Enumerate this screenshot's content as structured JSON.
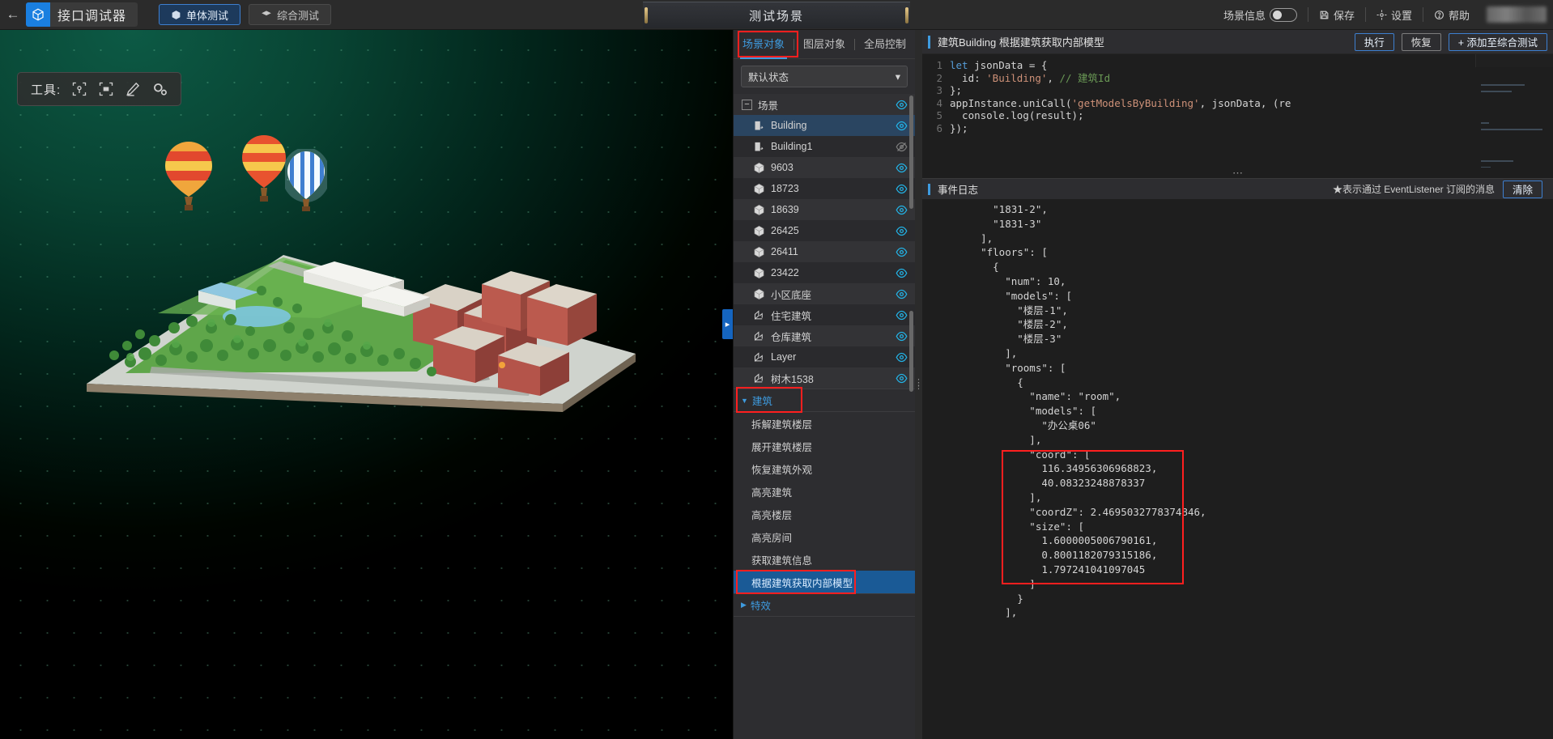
{
  "topbar": {
    "back_icon": "back-arrow-icon",
    "brand_logo_icon": "cube-logo-icon",
    "brand_name": "接口调试器",
    "modes": [
      {
        "label": "单体测试",
        "icon": "cube-icon",
        "active": true
      },
      {
        "label": "综合测试",
        "icon": "layers-icon",
        "active": false
      }
    ],
    "scene_title": "测试场景",
    "right": {
      "scene_info_label": "场景信息",
      "scene_info_toggle": "off",
      "save_label": "保存",
      "save_icon": "save-icon",
      "settings_label": "设置",
      "settings_icon": "gear-icon",
      "help_label": "帮助",
      "help_icon": "help-icon"
    }
  },
  "viewport": {
    "tools_label": "工具:",
    "tool_icons": [
      "target-select-icon",
      "box-select-icon",
      "pencil-icon",
      "gear-icon"
    ],
    "collapse_icon": "chevron-right-icon"
  },
  "scene_panel": {
    "tabs": [
      {
        "label": "场景对象",
        "active": true
      },
      {
        "label": "图层对象",
        "active": false
      },
      {
        "label": "全局控制",
        "active": false
      }
    ],
    "state_select": {
      "value": "默认状态",
      "icon": "chevron-down-icon"
    },
    "tree": [
      {
        "label": "场景",
        "icon": "minus-box",
        "depth": 0,
        "eye": "on",
        "selected": false
      },
      {
        "label": "Building",
        "icon": "building-icon",
        "depth": 1,
        "eye": "on",
        "selected": true
      },
      {
        "label": "Building1",
        "icon": "building-icon",
        "depth": 1,
        "eye": "off",
        "selected": false
      },
      {
        "label": "9603",
        "icon": "cube-icon",
        "depth": 1,
        "eye": "on",
        "selected": false
      },
      {
        "label": "18723",
        "icon": "cube-icon",
        "depth": 1,
        "eye": "on",
        "selected": false
      },
      {
        "label": "18639",
        "icon": "cube-icon",
        "depth": 1,
        "eye": "on",
        "selected": false
      },
      {
        "label": "26425",
        "icon": "cube-icon",
        "depth": 1,
        "eye": "on",
        "selected": false
      },
      {
        "label": "26411",
        "icon": "cube-icon",
        "depth": 1,
        "eye": "on",
        "selected": false
      },
      {
        "label": "23422",
        "icon": "cube-icon",
        "depth": 1,
        "eye": "on",
        "selected": false
      },
      {
        "label": "小区底座",
        "icon": "cube-icon",
        "depth": 1,
        "eye": "on",
        "selected": false
      },
      {
        "label": "住宅建筑",
        "icon": "layer-icon",
        "depth": 1,
        "eye": "on",
        "selected": false
      },
      {
        "label": "仓库建筑",
        "icon": "layer-icon",
        "depth": 1,
        "eye": "on",
        "selected": false
      },
      {
        "label": "Layer",
        "icon": "layer-icon",
        "depth": 1,
        "eye": "on",
        "selected": false
      },
      {
        "label": "树木1538",
        "icon": "layer-icon",
        "depth": 1,
        "eye": "on",
        "selected": false
      }
    ],
    "groups": [
      {
        "label": "建筑",
        "expanded": true,
        "highlighted": true,
        "items": [
          {
            "label": "拆解建筑楼层",
            "selected": false
          },
          {
            "label": "展开建筑楼层",
            "selected": false
          },
          {
            "label": "恢复建筑外观",
            "selected": false
          },
          {
            "label": "高亮建筑",
            "selected": false
          },
          {
            "label": "高亮楼层",
            "selected": false
          },
          {
            "label": "高亮房间",
            "selected": false
          },
          {
            "label": "获取建筑信息",
            "selected": false
          },
          {
            "label": "根据建筑获取内部模型",
            "selected": true
          }
        ]
      },
      {
        "label": "特效",
        "expanded": false,
        "highlighted": false,
        "items": []
      }
    ]
  },
  "code_panel": {
    "title": "建筑Building 根据建筑获取内部模型",
    "buttons": [
      {
        "label": "执行",
        "style": "outline-blue"
      },
      {
        "label": "恢复",
        "style": "outline-plain"
      },
      {
        "label": "+ 添加至综合测试",
        "style": "outline-blue"
      }
    ],
    "line_numbers": [
      "1",
      "2",
      "3",
      "4",
      "5",
      "6"
    ],
    "code": [
      "let jsonData = {",
      "  id: 'Building', // 建筑Id",
      "};",
      "appInstance.uniCall('getModelsByBuilding', jsonData, (re",
      "  console.log(result);",
      "});"
    ]
  },
  "log_panel": {
    "title": "事件日志",
    "note": "★表示通过 EventListener 订阅的消息",
    "clear_label": "清除",
    "content": "      \"1831-2\",\n      \"1831-3\"\n    ],\n    \"floors\": [\n      {\n        \"num\": 10,\n        \"models\": [\n          \"楼层-1\",\n          \"楼层-2\",\n          \"楼层-3\"\n        ],\n        \"rooms\": [\n          {\n            \"name\": \"room\",\n            \"models\": [\n              \"办公桌06\"\n            ],\n            \"coord\": [\n              116.34956306968823,\n              40.08323248878337\n            ],\n            \"coordZ\": 2.4695032778374846,\n            \"size\": [\n              1.6000005006790161,\n              0.8001182079315186,\n              1.797241041097045\n            ]\n          }\n        ],"
  },
  "colors": {
    "accent_blue": "#3e9bdf",
    "highlight_red": "#ff1f1f",
    "selected_row": "#1a5a96",
    "eye_on": "#22b4e8"
  }
}
